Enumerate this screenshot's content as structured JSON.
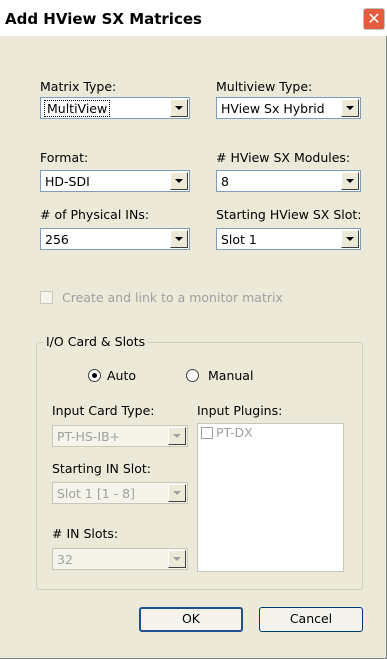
{
  "window": {
    "title": "Add HView SX Matrices",
    "close": "✕"
  },
  "matrix_type": {
    "label": "Matrix Type:",
    "value": "MultiView"
  },
  "multiview_type": {
    "label": "Multiview Type:",
    "value": "HView Sx Hybrid"
  },
  "format": {
    "label": "Format:",
    "value": "HD-SDI"
  },
  "modules": {
    "label": "# HView SX Modules:",
    "value": "8"
  },
  "physical_ins": {
    "label": "# of Physical INs:",
    "value": "256"
  },
  "starting_slot": {
    "label": "Starting HView SX Slot:",
    "value": "Slot 1"
  },
  "monitor_matrix": {
    "label": "Create and link to a monitor matrix",
    "checked": false
  },
  "io_group": {
    "legend": "I/O Card & Slots",
    "mode_auto": "Auto",
    "mode_manual": "Manual",
    "selected_mode": "Auto",
    "input_card_type": {
      "label": "Input Card Type:",
      "value": "PT-HS-IB+"
    },
    "input_plugins": {
      "label": "Input Plugins:",
      "items": [
        {
          "label": "PT-DX",
          "checked": false
        }
      ]
    },
    "starting_in_slot": {
      "label": "Starting IN Slot:",
      "value": "Slot 1 [1 - 8]"
    },
    "in_slots": {
      "label": "# IN Slots:",
      "value": "32"
    }
  },
  "buttons": {
    "ok": "OK",
    "cancel": "Cancel"
  }
}
